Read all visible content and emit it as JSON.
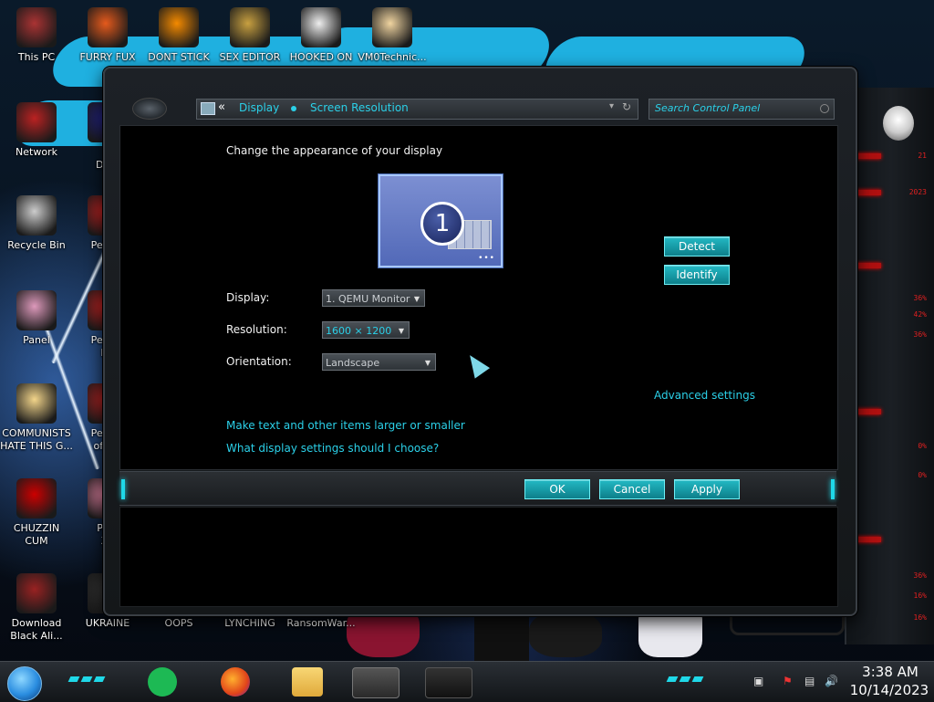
{
  "desktop": {
    "icons": [
      {
        "label": "This PC",
        "icon": "this-pc-icon"
      },
      {
        "label": "FURRY FUX",
        "icon": "firefox-icon"
      },
      {
        "label": "DONT STICK",
        "icon": "vlc-icon"
      },
      {
        "label": "SEX EDITOR",
        "icon": "hxd-icon"
      },
      {
        "label": "HOOKED ON",
        "icon": "maze-icon"
      },
      {
        "label": "VM0Technic...",
        "icon": "doctor-icon"
      },
      {
        "label": "Network",
        "icon": "network-icon"
      },
      {
        "label": "D\nDUM",
        "icon": "document-icon"
      },
      {
        "label": "Recycle Bin",
        "icon": "recycle-bin-icon"
      },
      {
        "label": "Peggle",
        "icon": "peggle-icon"
      },
      {
        "label": "Panel",
        "icon": "control-panel-icon"
      },
      {
        "label": "Peggle\nDe",
        "icon": "peggle-deluxe-icon"
      },
      {
        "label": "COMMUNISTS\nHATE THIS G...",
        "icon": "cartoon-girl-icon"
      },
      {
        "label": "Peggle\nof Wa",
        "icon": "peggle-nights-icon"
      },
      {
        "label": "CHUZZIN\nCUM",
        "icon": "chuzzle-icon"
      },
      {
        "label": "Plan\nZo",
        "icon": "pvz-icon"
      },
      {
        "label": "Download\nBlack Ali...",
        "icon": "alien-download-icon"
      },
      {
        "label": "UKRAINE",
        "icon": "ukraine-shortcut-icon"
      },
      {
        "label": "OOPS",
        "icon": "oops-shortcut-icon"
      },
      {
        "label": "LYNCHING",
        "icon": "lynching-shortcut-icon"
      },
      {
        "label": "RansomWar...",
        "icon": "ransomware-shortcut-icon"
      }
    ]
  },
  "gadgets": {
    "rows": [
      "21",
      "2023",
      "36%",
      "42%",
      "36%",
      "0%",
      "0%",
      "36%",
      "16%",
      "16%"
    ]
  },
  "window": {
    "breadcrumb_back": "«",
    "breadcrumb": [
      "Display",
      "Screen Resolution"
    ],
    "search_placeholder": "Search Control Panel",
    "heading": "Change the appearance of your display",
    "monitor_number": "1",
    "monitor_dots": "•••",
    "detect_label": "Detect",
    "identify_label": "Identify",
    "fields": {
      "display_label": "Display:",
      "display_value": "1. QEMU Monitor",
      "resolution_label": "Resolution:",
      "resolution_value": "1600 × 1200",
      "orientation_label": "Orientation:",
      "orientation_value": "Landscape"
    },
    "advanced_link": "Advanced settings",
    "link_text_size": "Make text and other items larger or smaller",
    "link_help": "What display settings should I choose?",
    "ok_label": "OK",
    "cancel_label": "Cancel",
    "apply_label": "Apply"
  },
  "taskbar": {
    "pinned": [
      "spotify-icon",
      "firefox-icon",
      "file-explorer-icon",
      "screen-resolution-window-icon",
      "alienware-app-icon"
    ],
    "time": "3:38 AM",
    "date": "10/14/2023"
  },
  "colors": {
    "accent": "#2bd0e8",
    "button": "#18a5b2",
    "alert": "#e02020"
  }
}
